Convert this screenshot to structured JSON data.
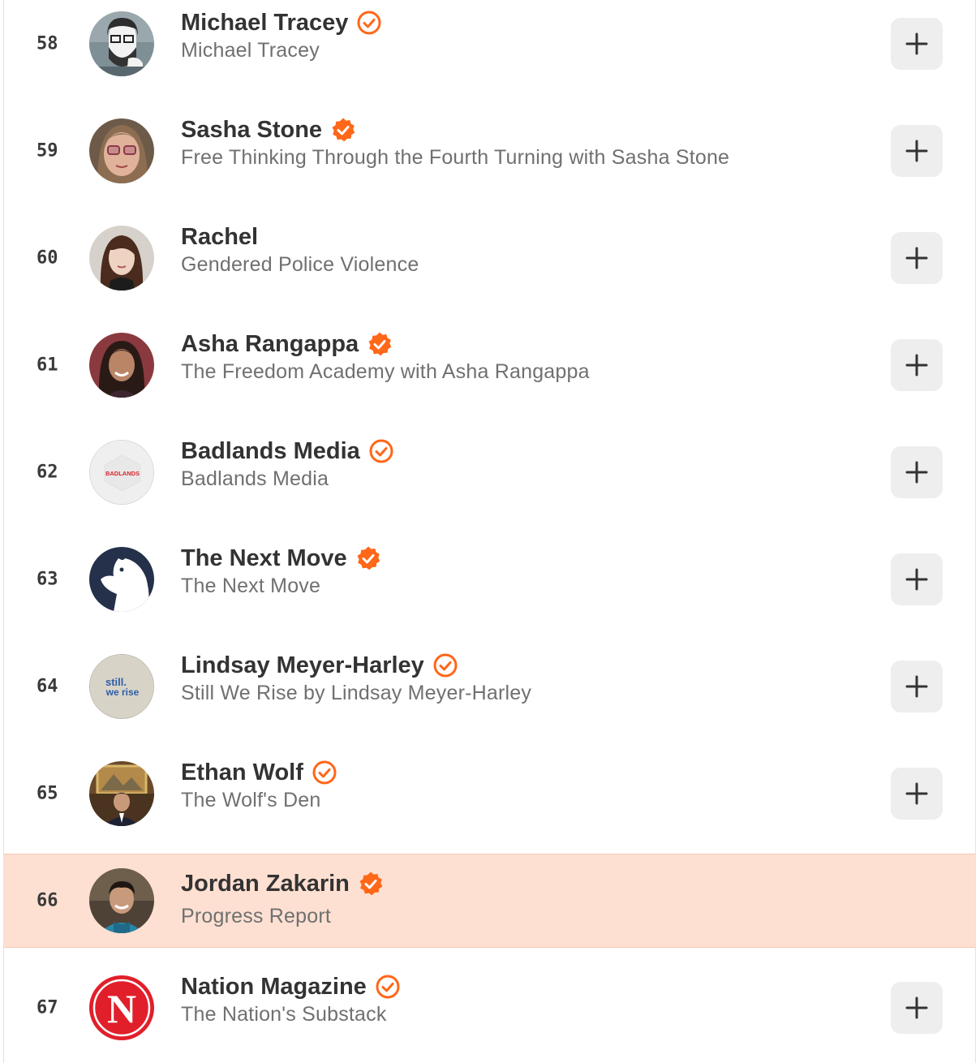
{
  "colors": {
    "accent": "#ff6719",
    "highlight_row": "#fde0d2",
    "button_bg": "#eeeeee"
  },
  "list": [
    {
      "rank": "58",
      "name": "Michael Tracey",
      "subtitle": "Michael Tracey",
      "badge": "outline",
      "avatar": "illustrated-man-avatar",
      "highlighted": false,
      "action": "add"
    },
    {
      "rank": "59",
      "name": "Sasha Stone",
      "subtitle": "Free Thinking Through the Fourth Turning with Sasha Stone",
      "badge": "filled",
      "avatar": "woman-glasses-avatar",
      "highlighted": false,
      "action": "add"
    },
    {
      "rank": "60",
      "name": "Rachel",
      "subtitle": "Gendered Police Violence",
      "badge": "none",
      "avatar": "woman-portrait-avatar",
      "highlighted": false,
      "action": "add"
    },
    {
      "rank": "61",
      "name": "Asha Rangappa",
      "subtitle": "The Freedom Academy with Asha Rangappa",
      "badge": "filled",
      "avatar": "woman-smiling-avatar",
      "highlighted": false,
      "action": "add"
    },
    {
      "rank": "62",
      "name": "Badlands Media",
      "subtitle": "Badlands Media",
      "badge": "outline",
      "avatar": "badlands-logo",
      "avatar_text": "BADLANDS",
      "highlighted": false,
      "action": "add"
    },
    {
      "rank": "63",
      "name": "The Next Move",
      "subtitle": "The Next Move",
      "badge": "filled",
      "avatar": "chess-knight-logo",
      "highlighted": false,
      "action": "add"
    },
    {
      "rank": "64",
      "name": "Lindsay Meyer-Harley",
      "subtitle": "Still We Rise by Lindsay Meyer-Harley",
      "badge": "outline",
      "avatar": "still-we-rise-logo",
      "avatar_text_1": "still.",
      "avatar_text_2": "we rise",
      "highlighted": false,
      "action": "add"
    },
    {
      "rank": "65",
      "name": "Ethan Wolf",
      "subtitle": "The Wolf's Den",
      "badge": "outline",
      "avatar": "man-suit-avatar",
      "highlighted": false,
      "action": "add"
    },
    {
      "rank": "66",
      "name": "Jordan Zakarin",
      "subtitle": "Progress Report",
      "badge": "filled",
      "avatar": "man-smiling-avatar",
      "highlighted": true,
      "action": "none"
    },
    {
      "rank": "67",
      "name": "Nation Magazine",
      "subtitle": "The Nation's Substack",
      "badge": "outline",
      "avatar": "nation-n-logo",
      "avatar_text": "N",
      "highlighted": false,
      "action": "add"
    }
  ]
}
